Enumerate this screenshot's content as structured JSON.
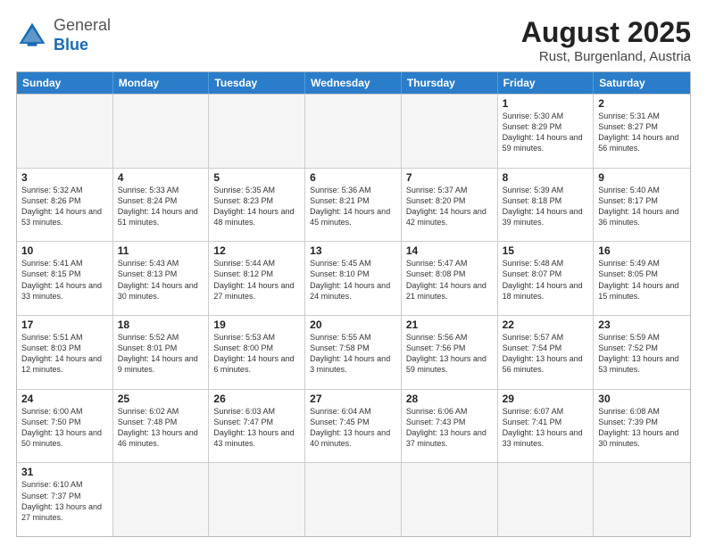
{
  "logo": {
    "text_general": "General",
    "text_blue": "Blue"
  },
  "title": "August 2025",
  "subtitle": "Rust, Burgenland, Austria",
  "header_days": [
    "Sunday",
    "Monday",
    "Tuesday",
    "Wednesday",
    "Thursday",
    "Friday",
    "Saturday"
  ],
  "weeks": [
    [
      {
        "day": "",
        "empty": true
      },
      {
        "day": "",
        "empty": true
      },
      {
        "day": "",
        "empty": true
      },
      {
        "day": "",
        "empty": true
      },
      {
        "day": "",
        "empty": true
      },
      {
        "day": "1",
        "info": "Sunrise: 5:30 AM\nSunset: 8:29 PM\nDaylight: 14 hours and 59 minutes."
      },
      {
        "day": "2",
        "info": "Sunrise: 5:31 AM\nSunset: 8:27 PM\nDaylight: 14 hours and 56 minutes."
      }
    ],
    [
      {
        "day": "3",
        "info": "Sunrise: 5:32 AM\nSunset: 8:26 PM\nDaylight: 14 hours and 53 minutes."
      },
      {
        "day": "4",
        "info": "Sunrise: 5:33 AM\nSunset: 8:24 PM\nDaylight: 14 hours and 51 minutes."
      },
      {
        "day": "5",
        "info": "Sunrise: 5:35 AM\nSunset: 8:23 PM\nDaylight: 14 hours and 48 minutes."
      },
      {
        "day": "6",
        "info": "Sunrise: 5:36 AM\nSunset: 8:21 PM\nDaylight: 14 hours and 45 minutes."
      },
      {
        "day": "7",
        "info": "Sunrise: 5:37 AM\nSunset: 8:20 PM\nDaylight: 14 hours and 42 minutes."
      },
      {
        "day": "8",
        "info": "Sunrise: 5:39 AM\nSunset: 8:18 PM\nDaylight: 14 hours and 39 minutes."
      },
      {
        "day": "9",
        "info": "Sunrise: 5:40 AM\nSunset: 8:17 PM\nDaylight: 14 hours and 36 minutes."
      }
    ],
    [
      {
        "day": "10",
        "info": "Sunrise: 5:41 AM\nSunset: 8:15 PM\nDaylight: 14 hours and 33 minutes."
      },
      {
        "day": "11",
        "info": "Sunrise: 5:43 AM\nSunset: 8:13 PM\nDaylight: 14 hours and 30 minutes."
      },
      {
        "day": "12",
        "info": "Sunrise: 5:44 AM\nSunset: 8:12 PM\nDaylight: 14 hours and 27 minutes."
      },
      {
        "day": "13",
        "info": "Sunrise: 5:45 AM\nSunset: 8:10 PM\nDaylight: 14 hours and 24 minutes."
      },
      {
        "day": "14",
        "info": "Sunrise: 5:47 AM\nSunset: 8:08 PM\nDaylight: 14 hours and 21 minutes."
      },
      {
        "day": "15",
        "info": "Sunrise: 5:48 AM\nSunset: 8:07 PM\nDaylight: 14 hours and 18 minutes."
      },
      {
        "day": "16",
        "info": "Sunrise: 5:49 AM\nSunset: 8:05 PM\nDaylight: 14 hours and 15 minutes."
      }
    ],
    [
      {
        "day": "17",
        "info": "Sunrise: 5:51 AM\nSunset: 8:03 PM\nDaylight: 14 hours and 12 minutes."
      },
      {
        "day": "18",
        "info": "Sunrise: 5:52 AM\nSunset: 8:01 PM\nDaylight: 14 hours and 9 minutes."
      },
      {
        "day": "19",
        "info": "Sunrise: 5:53 AM\nSunset: 8:00 PM\nDaylight: 14 hours and 6 minutes."
      },
      {
        "day": "20",
        "info": "Sunrise: 5:55 AM\nSunset: 7:58 PM\nDaylight: 14 hours and 3 minutes."
      },
      {
        "day": "21",
        "info": "Sunrise: 5:56 AM\nSunset: 7:56 PM\nDaylight: 13 hours and 59 minutes."
      },
      {
        "day": "22",
        "info": "Sunrise: 5:57 AM\nSunset: 7:54 PM\nDaylight: 13 hours and 56 minutes."
      },
      {
        "day": "23",
        "info": "Sunrise: 5:59 AM\nSunset: 7:52 PM\nDaylight: 13 hours and 53 minutes."
      }
    ],
    [
      {
        "day": "24",
        "info": "Sunrise: 6:00 AM\nSunset: 7:50 PM\nDaylight: 13 hours and 50 minutes."
      },
      {
        "day": "25",
        "info": "Sunrise: 6:02 AM\nSunset: 7:48 PM\nDaylight: 13 hours and 46 minutes."
      },
      {
        "day": "26",
        "info": "Sunrise: 6:03 AM\nSunset: 7:47 PM\nDaylight: 13 hours and 43 minutes."
      },
      {
        "day": "27",
        "info": "Sunrise: 6:04 AM\nSunset: 7:45 PM\nDaylight: 13 hours and 40 minutes."
      },
      {
        "day": "28",
        "info": "Sunrise: 6:06 AM\nSunset: 7:43 PM\nDaylight: 13 hours and 37 minutes."
      },
      {
        "day": "29",
        "info": "Sunrise: 6:07 AM\nSunset: 7:41 PM\nDaylight: 13 hours and 33 minutes."
      },
      {
        "day": "30",
        "info": "Sunrise: 6:08 AM\nSunset: 7:39 PM\nDaylight: 13 hours and 30 minutes."
      }
    ],
    [
      {
        "day": "31",
        "info": "Sunrise: 6:10 AM\nSunset: 7:37 PM\nDaylight: 13 hours and 27 minutes."
      },
      {
        "day": "",
        "empty": true
      },
      {
        "day": "",
        "empty": true
      },
      {
        "day": "",
        "empty": true
      },
      {
        "day": "",
        "empty": true
      },
      {
        "day": "",
        "empty": true
      },
      {
        "day": "",
        "empty": true
      }
    ]
  ]
}
